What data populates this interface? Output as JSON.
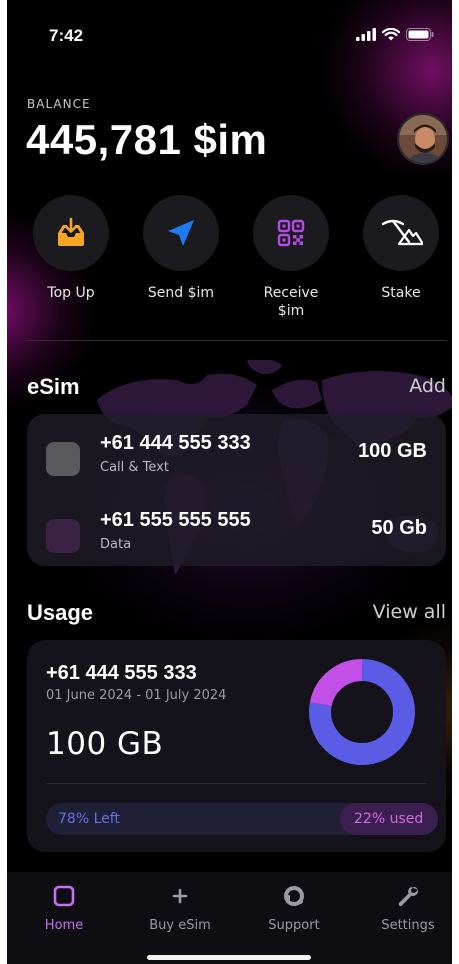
{
  "status": {
    "time": "7:42"
  },
  "balance": {
    "label": "BALANCE",
    "value": "445,781 $im"
  },
  "actions": [
    {
      "label": "Top Up",
      "icon": "inbox-download-icon",
      "color": "#f5a623"
    },
    {
      "label": "Send $im",
      "icon": "send-icon",
      "color": "#1e7cf2"
    },
    {
      "label": "Receive $im",
      "icon": "qr-code-icon",
      "color": "#b44be6"
    },
    {
      "label": "Stake",
      "icon": "pickaxe-mountain-icon",
      "color": "#ffffff"
    }
  ],
  "esim": {
    "title": "eSim",
    "add_label": "Add",
    "items": [
      {
        "number": "+61 444 555 333",
        "type": "Call & Text",
        "data": "100 GB",
        "color": "#5a5a5e"
      },
      {
        "number": "+61 555 555 555",
        "type": "Data",
        "data": "50 Gb",
        "color": "#3a2244"
      }
    ]
  },
  "usage": {
    "title": "Usage",
    "view_all_label": "View all",
    "number": "+61 444 555 333",
    "period": "01 June 2024 - 01 July 2024",
    "total": "100 GB",
    "left_label": "78% Left",
    "used_label": "22% used",
    "left_fraction": 0.78,
    "used_fraction": 0.22,
    "left_color": "#5b5ce6",
    "used_color": "#c24fe8"
  },
  "tabs": [
    {
      "label": "Home",
      "icon": "home-square-icon",
      "active": true
    },
    {
      "label": "Buy eSim",
      "icon": "plus-icon",
      "active": false
    },
    {
      "label": "Support",
      "icon": "headset-icon",
      "active": false
    },
    {
      "label": "Settings",
      "icon": "wrench-icon",
      "active": false
    }
  ]
}
